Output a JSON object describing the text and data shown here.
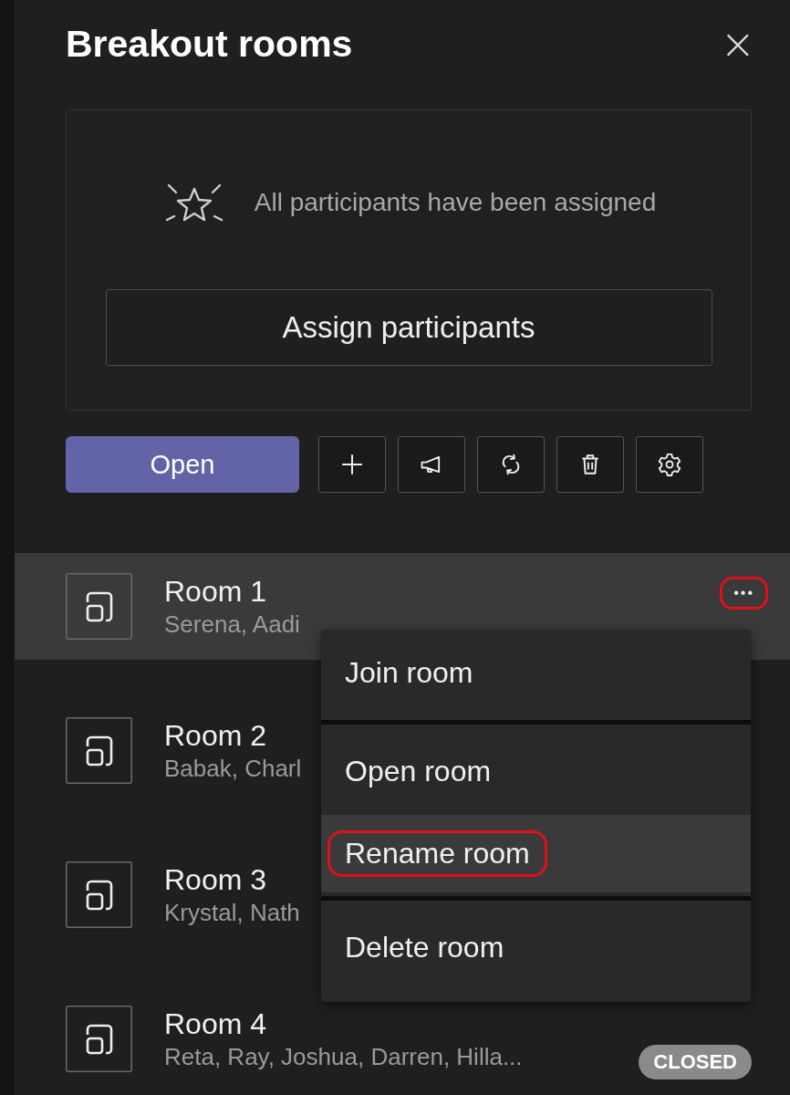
{
  "panel": {
    "title": "Breakout rooms",
    "close_label": "×"
  },
  "assign_card": {
    "message": "All participants have been assigned",
    "button": "Assign participants"
  },
  "toolbar": {
    "open_button": "Open",
    "tools": [
      {
        "kind": "add"
      },
      {
        "kind": "announce"
      },
      {
        "kind": "recreate"
      },
      {
        "kind": "delete"
      },
      {
        "kind": "settings"
      }
    ]
  },
  "rooms": [
    {
      "name": "Room 1",
      "participants": "Serena, Aadi",
      "selected": true,
      "more_button": {
        "label": "•••",
        "highlighted": true
      }
    },
    {
      "name": "Room 2",
      "participants": "Babak, Charl",
      "selected": false
    },
    {
      "name": "Room 3",
      "participants": "Krystal, Nath",
      "selected": false
    },
    {
      "name": "Room 4",
      "participants": "Reta, Ray, Joshua, Darren, Hilla...",
      "selected": false,
      "status": "CLOSED"
    }
  ],
  "context_menu": {
    "items": [
      {
        "kind": "item",
        "label": "Join room",
        "hovered": false,
        "highlighted": false
      },
      {
        "kind": "divider"
      },
      {
        "kind": "item",
        "label": "Open room",
        "hovered": false,
        "highlighted": false
      },
      {
        "kind": "item",
        "label": "Rename room",
        "hovered": true,
        "highlighted": true
      },
      {
        "kind": "divider"
      },
      {
        "kind": "item",
        "label": "Delete room",
        "hovered": false,
        "highlighted": false
      }
    ]
  }
}
